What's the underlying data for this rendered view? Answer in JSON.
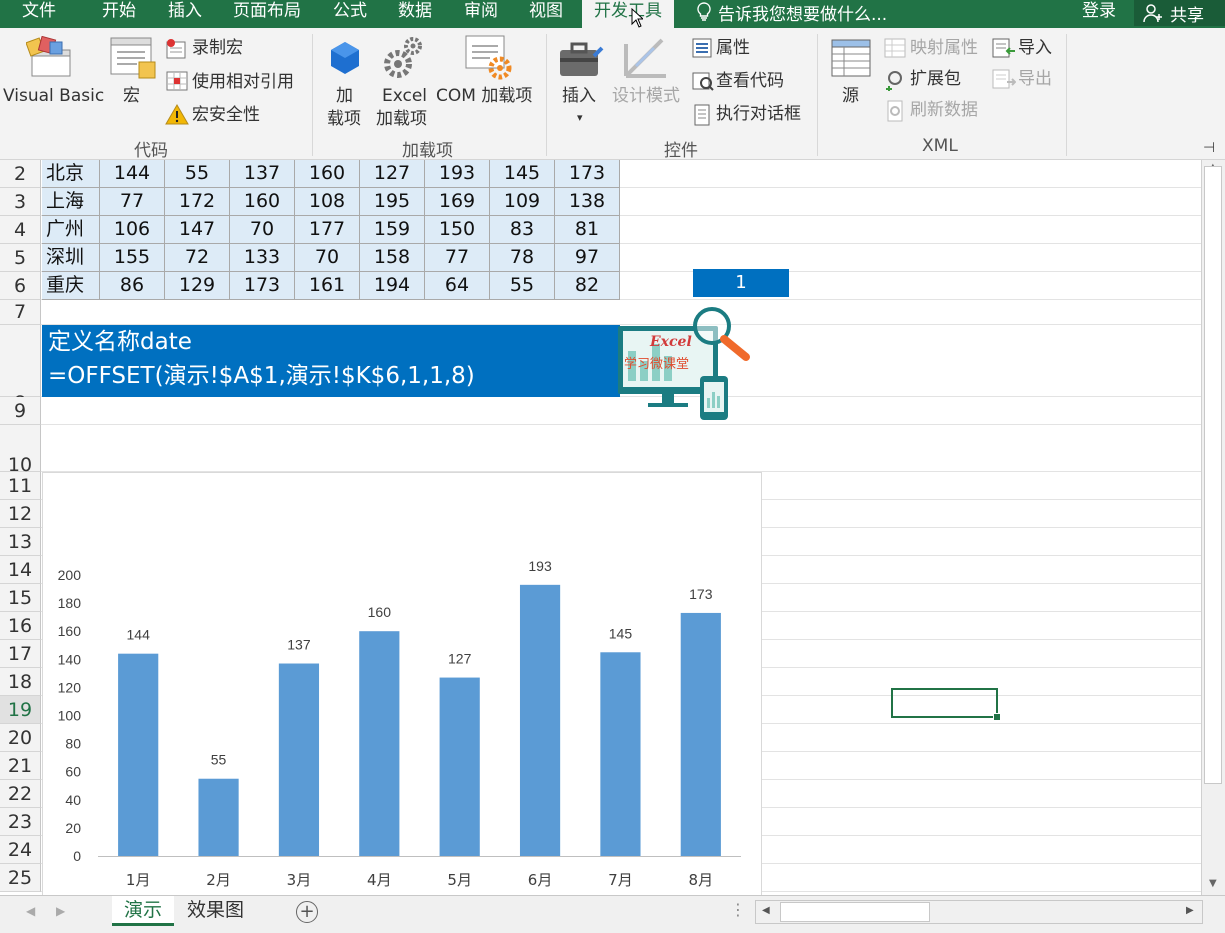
{
  "menu": {
    "tabs": [
      "文件",
      "开始",
      "插入",
      "页面布局",
      "公式",
      "数据",
      "审阅",
      "视图",
      "开发工具"
    ],
    "tell_me": "告诉我您想要做什么...",
    "login": "登录",
    "share": "共享"
  },
  "ribbon": {
    "visual_basic": "Visual Basic",
    "macro": "宏",
    "record_macro": "录制宏",
    "relative_ref": "使用相对引用",
    "macro_security": "宏安全性",
    "group_code": "代码",
    "addin_line1": "加",
    "addin_line2": "载项",
    "excel_addin_line1": "Excel",
    "excel_addin_line2": "加载项",
    "com_addin": "COM 加载项",
    "group_addins": "加载项",
    "insert": "插入",
    "design_mode": "设计模式",
    "properties": "属性",
    "view_code": "查看代码",
    "run_dialog": "执行对话框",
    "group_controls": "控件",
    "source": "源",
    "map_properties": "映射属性",
    "expansion_packs": "扩展包",
    "refresh_data": "刷新数据",
    "import": "导入",
    "export": "导出",
    "group_xml": "XML"
  },
  "rows": [
    "2",
    "3",
    "4",
    "5",
    "6",
    "7",
    "8",
    "9",
    "10",
    "11",
    "12",
    "13",
    "14",
    "15",
    "16",
    "17",
    "18",
    "19",
    "20",
    "21",
    "22",
    "23",
    "24",
    "25"
  ],
  "table": [
    {
      "city": "北京",
      "values": [
        "144",
        "55",
        "137",
        "160",
        "127",
        "193",
        "145",
        "173"
      ]
    },
    {
      "city": "上海",
      "values": [
        "77",
        "172",
        "160",
        "108",
        "195",
        "169",
        "109",
        "138"
      ]
    },
    {
      "city": "广州",
      "values": [
        "106",
        "147",
        "70",
        "177",
        "159",
        "150",
        "83",
        "81"
      ]
    },
    {
      "city": "深圳",
      "values": [
        "155",
        "72",
        "133",
        "70",
        "158",
        "77",
        "78",
        "97"
      ]
    },
    {
      "city": "重庆",
      "values": [
        "86",
        "129",
        "173",
        "161",
        "194",
        "64",
        "55",
        "82"
      ]
    }
  ],
  "k6_value": "1",
  "definition": {
    "line1": "定义名称date",
    "line2": "=OFFSET(演示!$A$1,演示!$K$6,1,1,8)"
  },
  "logo": {
    "word": "Excel",
    "caption": "学习微课堂"
  },
  "chart_data": {
    "type": "bar",
    "categories": [
      "1月",
      "2月",
      "3月",
      "4月",
      "5月",
      "6月",
      "7月",
      "8月"
    ],
    "values": [
      144,
      55,
      137,
      160,
      127,
      193,
      145,
      173
    ],
    "ylim": [
      0,
      200
    ],
    "yticks": [
      0,
      20,
      40,
      60,
      80,
      100,
      120,
      140,
      160,
      180,
      200
    ],
    "color": "#5b9bd5",
    "data_labels": true,
    "grid": false
  },
  "sheet_tabs": [
    "演示",
    "效果图"
  ],
  "colors": {
    "accent": "#217346",
    "highlight": "#0070c0",
    "table_fill": "#ddebf7"
  }
}
